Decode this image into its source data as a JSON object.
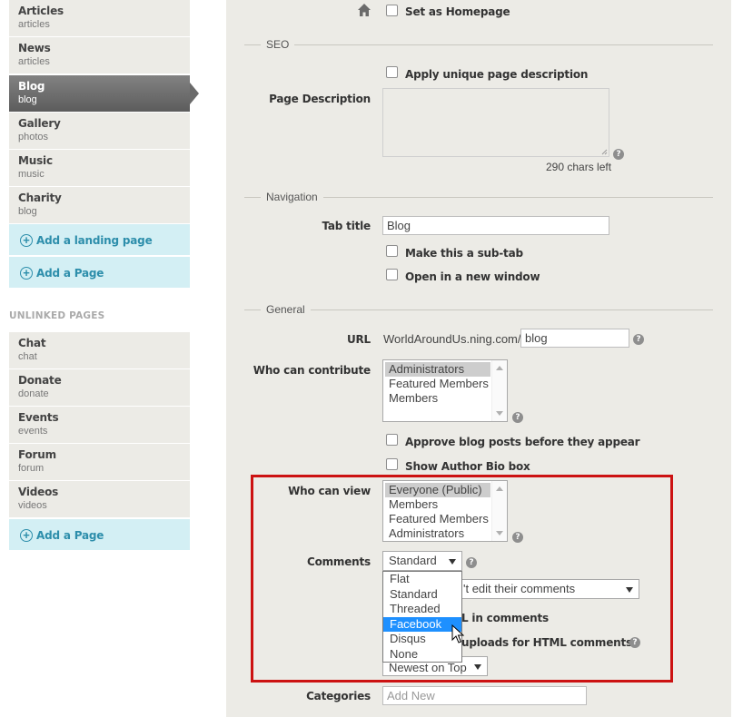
{
  "sidebar": {
    "linked_pages": [
      {
        "title": "Articles",
        "sub": "articles"
      },
      {
        "title": "News",
        "sub": "articles"
      },
      {
        "title": "Blog",
        "sub": "blog",
        "active": true
      },
      {
        "title": "Gallery",
        "sub": "photos"
      },
      {
        "title": "Music",
        "sub": "music"
      },
      {
        "title": "Charity",
        "sub": "blog"
      }
    ],
    "add_landing_label": "Add a landing page",
    "add_page_label": "Add a Page",
    "unlinked_heading": "UNLINKED PAGES",
    "unlinked_pages": [
      {
        "title": "Chat",
        "sub": "chat"
      },
      {
        "title": "Donate",
        "sub": "donate"
      },
      {
        "title": "Events",
        "sub": "events"
      },
      {
        "title": "Forum",
        "sub": "forum"
      },
      {
        "title": "Videos",
        "sub": "videos"
      }
    ],
    "add_page_label_2": "Add a Page"
  },
  "form": {
    "set_homepage_label": "Set as Homepage",
    "seo_legend": "SEO",
    "unique_desc_label": "Apply unique page description",
    "page_desc_label": "Page Description",
    "chars_left": "290 chars left",
    "nav_legend": "Navigation",
    "tab_title_label": "Tab title",
    "tab_title_value": "Blog",
    "subtab_label": "Make this a sub-tab",
    "new_window_label": "Open in a new window",
    "general_legend": "General",
    "url_label": "URL",
    "url_prefix": "WorldAroundUs.ning.com/",
    "url_value": "blog",
    "contribute_label": "Who can contribute",
    "contribute_options": [
      "Administrators",
      "Featured Members",
      "Members"
    ],
    "approve_label": "Approve blog posts before they appear",
    "author_bio_label": "Show Author Bio box",
    "view_label": "Who can view",
    "view_options": [
      "Everyone (Public)",
      "Members",
      "Featured Members",
      "Administrators"
    ],
    "comments_label": "Comments",
    "comments_value": "Standard",
    "comments_options": [
      "Flat",
      "Standard",
      "Threaded",
      "Facebook",
      "Disqus",
      "None"
    ],
    "edit_select_partial": "'t edit their comments",
    "url_in_comments_partial": "L in comments",
    "uploads_partial": "uploads for HTML comments",
    "order_partial": "Newest on Top",
    "categories_label": "Categories",
    "categories_placeholder": "Add New"
  },
  "colors": {
    "highlight_border": "#cc1212",
    "dropdown_highlight": "#1e90ff",
    "link": "#2d8eab"
  }
}
